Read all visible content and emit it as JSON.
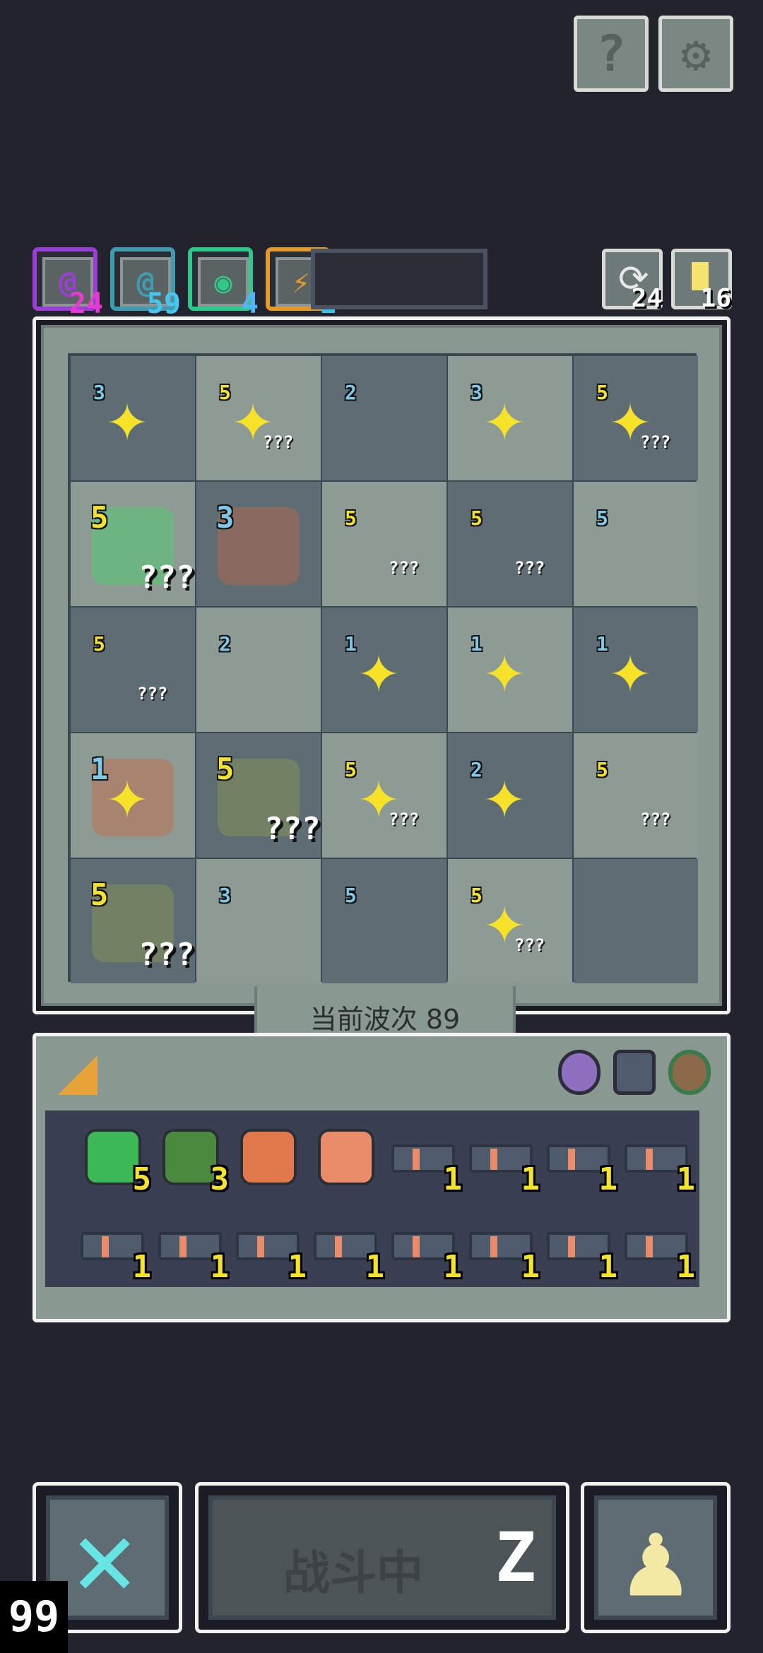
{
  "top_buttons": {
    "help_label": "?",
    "settings_label": "⚙"
  },
  "resources": [
    {
      "icon": "@",
      "value": "24",
      "color": "#9b3ed6",
      "num_color": "#e83ad2"
    },
    {
      "icon": "@",
      "value": "59",
      "color": "#3f9bb0",
      "num_color": "#44c6f0"
    },
    {
      "icon": "◉",
      "value": "4",
      "color": "#2ec98a",
      "num_color": "#4fb7ff"
    },
    {
      "icon": "⚡",
      "value": "1",
      "color": "#e39a2d",
      "num_color": "#37c2e8"
    }
  ],
  "refresh": {
    "value": "24"
  },
  "key": {
    "value": "16"
  },
  "board": {
    "rows": [
      [
        {
          "lvl": "3",
          "lc": "#7ec9e8",
          "star": true,
          "q": ""
        },
        {
          "lvl": "5",
          "lc": "#f5e32b",
          "star": true,
          "q": "???"
        },
        {
          "lvl": "2",
          "lc": "#7ec9e8",
          "star": false,
          "q": ""
        },
        {
          "lvl": "3",
          "lc": "#7ec9e8",
          "star": true,
          "q": ""
        },
        {
          "lvl": "5",
          "lc": "#f5e32b",
          "star": true,
          "q": "???"
        }
      ],
      [
        {
          "lvl": "5",
          "lc": "#f5e32b",
          "star": false,
          "q": "???",
          "mon": "#5fbf7a",
          "big": true
        },
        {
          "lvl": "3",
          "lc": "#7ec9e8",
          "star": false,
          "q": "",
          "mon": "#9b6a55",
          "big": true
        },
        {
          "lvl": "5",
          "lc": "#f5e32b",
          "star": false,
          "q": "???"
        },
        {
          "lvl": "5",
          "lc": "#f5e32b",
          "star": false,
          "q": "???"
        },
        {
          "lvl": "5",
          "lc": "#7ec9e8",
          "star": false,
          "q": ""
        }
      ],
      [
        {
          "lvl": "5",
          "lc": "#f5e32b",
          "star": false,
          "q": "???"
        },
        {
          "lvl": "2",
          "lc": "#7ec9e8",
          "star": false,
          "q": ""
        },
        {
          "lvl": "1",
          "lc": "#7ec9e8",
          "star": true,
          "q": ""
        },
        {
          "lvl": "1",
          "lc": "#7ec9e8",
          "star": true,
          "q": ""
        },
        {
          "lvl": "1",
          "lc": "#7ec9e8",
          "star": true,
          "q": ""
        }
      ],
      [
        {
          "lvl": "1",
          "lc": "#7ec9e8",
          "star": true,
          "q": "",
          "mon": "#b07a60",
          "big": true
        },
        {
          "lvl": "5",
          "lc": "#f5e32b",
          "star": false,
          "q": "???",
          "mon": "#7a8a5c",
          "big": true
        },
        {
          "lvl": "5",
          "lc": "#f5e32b",
          "star": true,
          "q": "???"
        },
        {
          "lvl": "2",
          "lc": "#7ec9e8",
          "star": true,
          "q": ""
        },
        {
          "lvl": "5",
          "lc": "#f5e32b",
          "star": false,
          "q": "???"
        }
      ],
      [
        {
          "lvl": "5",
          "lc": "#f5e32b",
          "star": false,
          "q": "???",
          "mon": "#7a8a5c",
          "big": true
        },
        {
          "lvl": "3",
          "lc": "#7ec9e8",
          "star": false,
          "q": ""
        },
        {
          "lvl": "5",
          "lc": "#7ec9e8",
          "star": false,
          "q": ""
        },
        {
          "lvl": "5",
          "lc": "#f5e32b",
          "star": true,
          "q": "???"
        },
        {
          "lvl": "",
          "lc": "#7ec9e8",
          "star": false,
          "q": ""
        }
      ]
    ]
  },
  "wave": {
    "label": "当前波次 89"
  },
  "inventory": {
    "items": [
      {
        "name": "emerald-icon",
        "color": "#3db856",
        "count": "5"
      },
      {
        "name": "soldier-icon",
        "color": "#4b8a3e",
        "count": "3"
      },
      {
        "name": "armor-icon",
        "color": "#e07a4a",
        "count": ""
      },
      {
        "name": "bullet-icon",
        "color": "#e98c6a",
        "count": ""
      },
      {
        "name": "gun-icon",
        "color": "#4d5b6d",
        "count": "1"
      },
      {
        "name": "gun-icon",
        "color": "#4d5b6d",
        "count": "1"
      },
      {
        "name": "gun-icon",
        "color": "#4d5b6d",
        "count": "1"
      },
      {
        "name": "gun-icon",
        "color": "#4d5b6d",
        "count": "1"
      },
      {
        "name": "gun-icon",
        "color": "#4d5b6d",
        "count": "1"
      },
      {
        "name": "gun-icon",
        "color": "#4d5b6d",
        "count": "1"
      },
      {
        "name": "gun-icon",
        "color": "#4d5b6d",
        "count": "1"
      },
      {
        "name": "gun-icon",
        "color": "#4d5b6d",
        "count": "1"
      },
      {
        "name": "gun-icon",
        "color": "#4d5b6d",
        "count": "1"
      },
      {
        "name": "gun-icon",
        "color": "#4d5b6d",
        "count": "1"
      },
      {
        "name": "gun-icon",
        "color": "#4d5b6d",
        "count": "1"
      },
      {
        "name": "gun-icon",
        "color": "#4d5b6d",
        "count": "1"
      }
    ]
  },
  "bottom": {
    "fight_label": "战斗中",
    "speed": "99"
  }
}
